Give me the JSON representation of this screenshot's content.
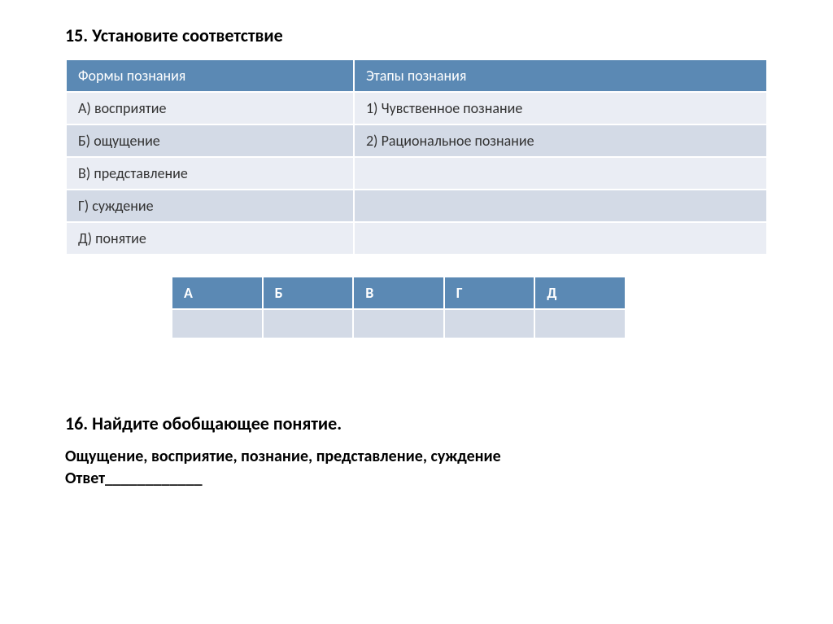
{
  "q15": {
    "title": "15. Установите соответствие",
    "headers": {
      "left": "Формы познания",
      "right": "Этапы  познания"
    },
    "rows": [
      {
        "left": "А) восприятие",
        "right": "1) Чувственное познание"
      },
      {
        "left": "Б) ощущение",
        "right": "2) Рациональное познание"
      },
      {
        "left": "В) представление",
        "right": ""
      },
      {
        "left": "Г) суждение",
        "right": ""
      },
      {
        "left": "Д) понятие",
        "right": ""
      }
    ],
    "answer_headers": [
      "А",
      "Б",
      "В",
      "Г",
      "Д"
    ]
  },
  "q16": {
    "title": "16. Найдите обобщающее понятие.",
    "prompt": "Ощущение, восприятие, познание, представление, суждение",
    "answer_label": "Ответ____________"
  }
}
